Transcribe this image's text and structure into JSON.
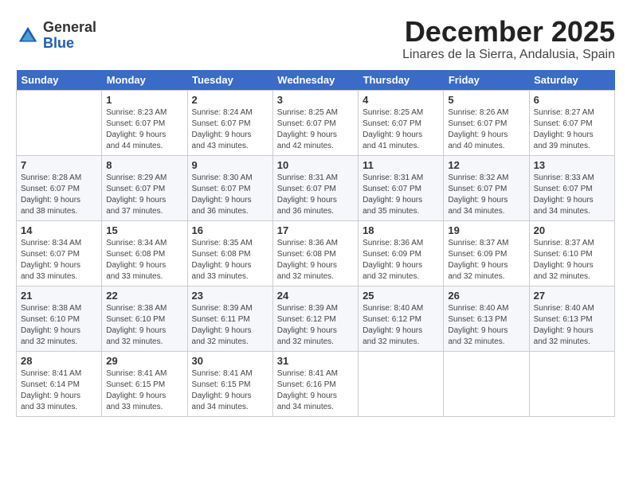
{
  "logo": {
    "general": "General",
    "blue": "Blue"
  },
  "title": "December 2025",
  "location": "Linares de la Sierra, Andalusia, Spain",
  "days_of_week": [
    "Sunday",
    "Monday",
    "Tuesday",
    "Wednesday",
    "Thursday",
    "Friday",
    "Saturday"
  ],
  "weeks": [
    [
      {
        "num": "",
        "info": ""
      },
      {
        "num": "1",
        "info": "Sunrise: 8:23 AM\nSunset: 6:07 PM\nDaylight: 9 hours\nand 44 minutes."
      },
      {
        "num": "2",
        "info": "Sunrise: 8:24 AM\nSunset: 6:07 PM\nDaylight: 9 hours\nand 43 minutes."
      },
      {
        "num": "3",
        "info": "Sunrise: 8:25 AM\nSunset: 6:07 PM\nDaylight: 9 hours\nand 42 minutes."
      },
      {
        "num": "4",
        "info": "Sunrise: 8:25 AM\nSunset: 6:07 PM\nDaylight: 9 hours\nand 41 minutes."
      },
      {
        "num": "5",
        "info": "Sunrise: 8:26 AM\nSunset: 6:07 PM\nDaylight: 9 hours\nand 40 minutes."
      },
      {
        "num": "6",
        "info": "Sunrise: 8:27 AM\nSunset: 6:07 PM\nDaylight: 9 hours\nand 39 minutes."
      }
    ],
    [
      {
        "num": "7",
        "info": "Sunrise: 8:28 AM\nSunset: 6:07 PM\nDaylight: 9 hours\nand 38 minutes."
      },
      {
        "num": "8",
        "info": "Sunrise: 8:29 AM\nSunset: 6:07 PM\nDaylight: 9 hours\nand 37 minutes."
      },
      {
        "num": "9",
        "info": "Sunrise: 8:30 AM\nSunset: 6:07 PM\nDaylight: 9 hours\nand 36 minutes."
      },
      {
        "num": "10",
        "info": "Sunrise: 8:31 AM\nSunset: 6:07 PM\nDaylight: 9 hours\nand 36 minutes."
      },
      {
        "num": "11",
        "info": "Sunrise: 8:31 AM\nSunset: 6:07 PM\nDaylight: 9 hours\nand 35 minutes."
      },
      {
        "num": "12",
        "info": "Sunrise: 8:32 AM\nSunset: 6:07 PM\nDaylight: 9 hours\nand 34 minutes."
      },
      {
        "num": "13",
        "info": "Sunrise: 8:33 AM\nSunset: 6:07 PM\nDaylight: 9 hours\nand 34 minutes."
      }
    ],
    [
      {
        "num": "14",
        "info": "Sunrise: 8:34 AM\nSunset: 6:07 PM\nDaylight: 9 hours\nand 33 minutes."
      },
      {
        "num": "15",
        "info": "Sunrise: 8:34 AM\nSunset: 6:08 PM\nDaylight: 9 hours\nand 33 minutes."
      },
      {
        "num": "16",
        "info": "Sunrise: 8:35 AM\nSunset: 6:08 PM\nDaylight: 9 hours\nand 33 minutes."
      },
      {
        "num": "17",
        "info": "Sunrise: 8:36 AM\nSunset: 6:08 PM\nDaylight: 9 hours\nand 32 minutes."
      },
      {
        "num": "18",
        "info": "Sunrise: 8:36 AM\nSunset: 6:09 PM\nDaylight: 9 hours\nand 32 minutes."
      },
      {
        "num": "19",
        "info": "Sunrise: 8:37 AM\nSunset: 6:09 PM\nDaylight: 9 hours\nand 32 minutes."
      },
      {
        "num": "20",
        "info": "Sunrise: 8:37 AM\nSunset: 6:10 PM\nDaylight: 9 hours\nand 32 minutes."
      }
    ],
    [
      {
        "num": "21",
        "info": "Sunrise: 8:38 AM\nSunset: 6:10 PM\nDaylight: 9 hours\nand 32 minutes."
      },
      {
        "num": "22",
        "info": "Sunrise: 8:38 AM\nSunset: 6:10 PM\nDaylight: 9 hours\nand 32 minutes."
      },
      {
        "num": "23",
        "info": "Sunrise: 8:39 AM\nSunset: 6:11 PM\nDaylight: 9 hours\nand 32 minutes."
      },
      {
        "num": "24",
        "info": "Sunrise: 8:39 AM\nSunset: 6:12 PM\nDaylight: 9 hours\nand 32 minutes."
      },
      {
        "num": "25",
        "info": "Sunrise: 8:40 AM\nSunset: 6:12 PM\nDaylight: 9 hours\nand 32 minutes."
      },
      {
        "num": "26",
        "info": "Sunrise: 8:40 AM\nSunset: 6:13 PM\nDaylight: 9 hours\nand 32 minutes."
      },
      {
        "num": "27",
        "info": "Sunrise: 8:40 AM\nSunset: 6:13 PM\nDaylight: 9 hours\nand 32 minutes."
      }
    ],
    [
      {
        "num": "28",
        "info": "Sunrise: 8:41 AM\nSunset: 6:14 PM\nDaylight: 9 hours\nand 33 minutes."
      },
      {
        "num": "29",
        "info": "Sunrise: 8:41 AM\nSunset: 6:15 PM\nDaylight: 9 hours\nand 33 minutes."
      },
      {
        "num": "30",
        "info": "Sunrise: 8:41 AM\nSunset: 6:15 PM\nDaylight: 9 hours\nand 34 minutes."
      },
      {
        "num": "31",
        "info": "Sunrise: 8:41 AM\nSunset: 6:16 PM\nDaylight: 9 hours\nand 34 minutes."
      },
      {
        "num": "",
        "info": ""
      },
      {
        "num": "",
        "info": ""
      },
      {
        "num": "",
        "info": ""
      }
    ]
  ]
}
